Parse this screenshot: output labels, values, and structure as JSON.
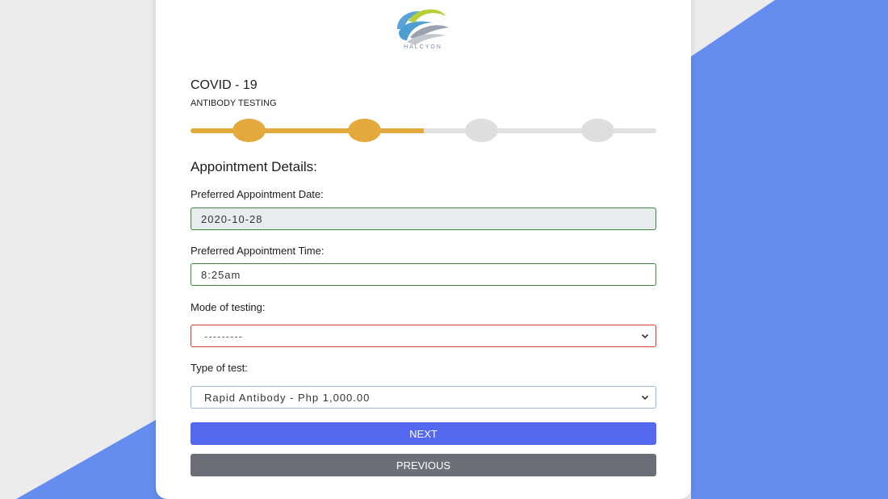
{
  "brand": {
    "logo_text": "HALCYON"
  },
  "header": {
    "title": "COVID - 19",
    "subtitle": "ANTIBODY TESTING"
  },
  "progress": {
    "current_step": 2,
    "total_steps": 4,
    "fill_fraction": 0.5,
    "accent": "#e3a93d"
  },
  "section": {
    "heading": "Appointment Details:"
  },
  "fields": {
    "date": {
      "label": "Preferred Appointment Date:",
      "value": "2020-10-28"
    },
    "time": {
      "label": "Preferred Appointment Time:",
      "value": "8:25am"
    },
    "mode": {
      "label": "Mode of testing:",
      "selected": "---------"
    },
    "test_type": {
      "label": "Type of test:",
      "selected": "Rapid Antibody - Php 1,000.00"
    }
  },
  "buttons": {
    "next": "NEXT",
    "previous": "PREVIOUS"
  },
  "colors": {
    "background_shape": "#658df0",
    "next_button": "#5469f0",
    "previous_button": "#6b7078",
    "valid_border": "#3a8a3a",
    "invalid_border": "#d33a3a"
  },
  "icons": {
    "select_arrow": "chevron-down-icon"
  }
}
